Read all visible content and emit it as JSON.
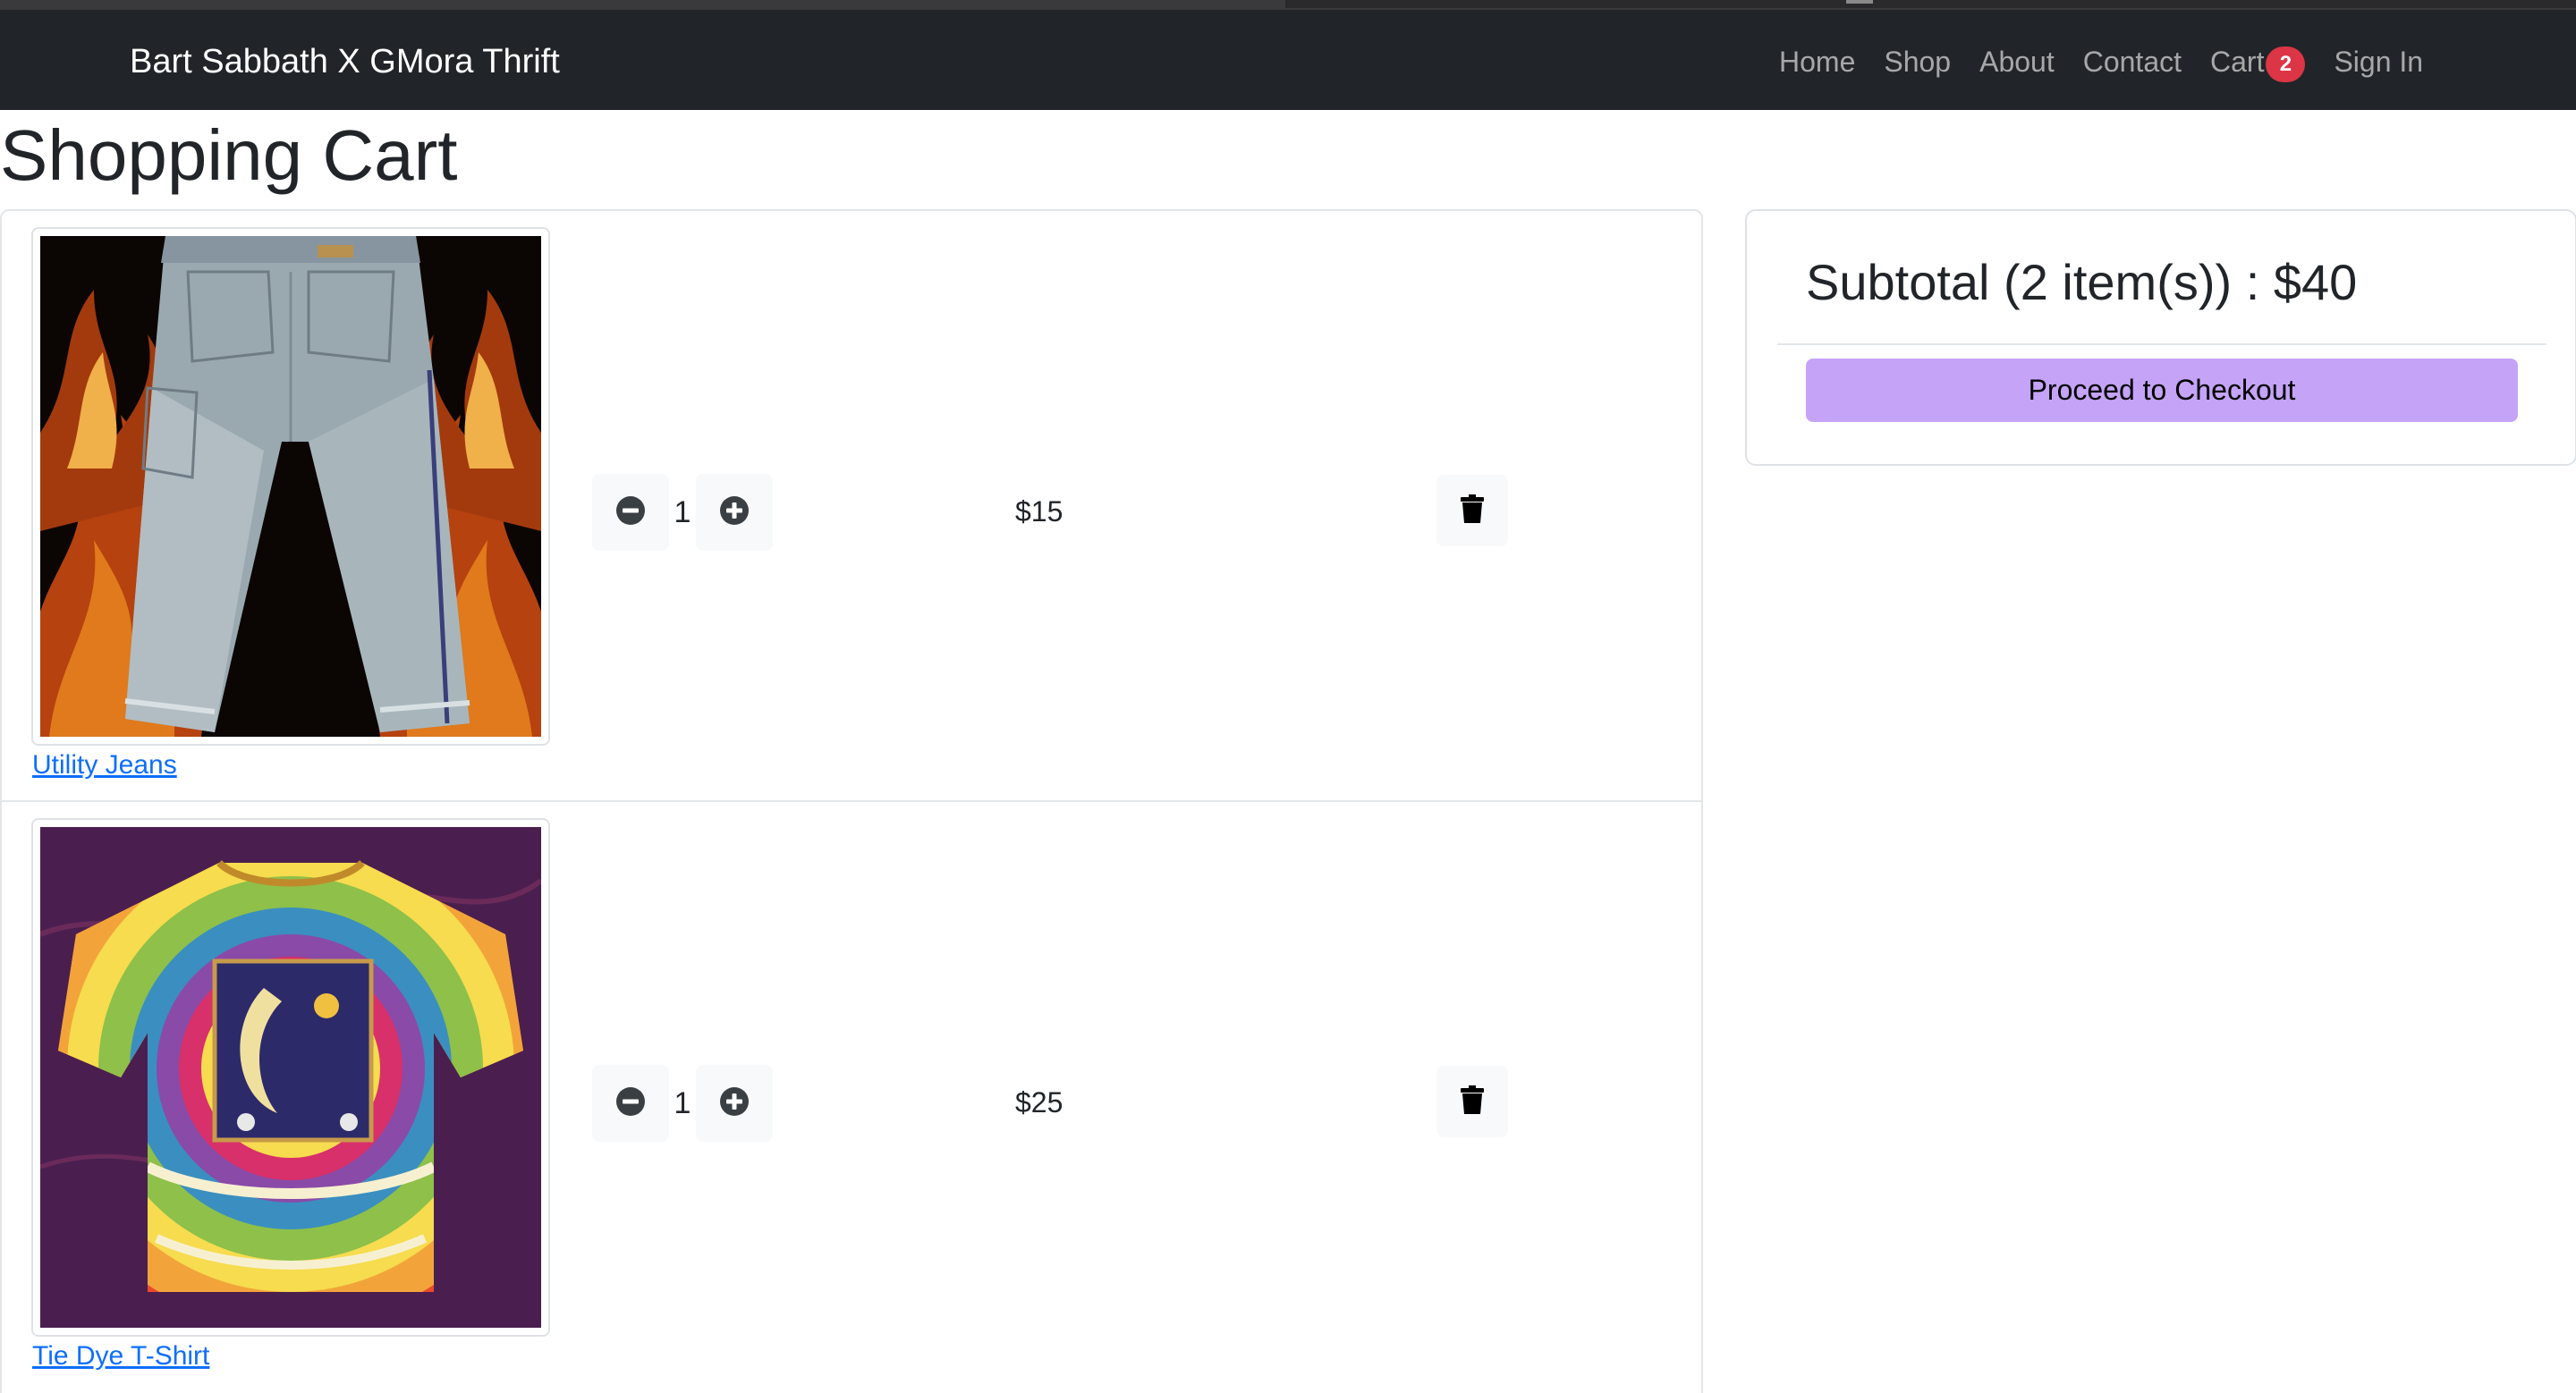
{
  "navbar": {
    "brand": "Bart Sabbath X GMora Thrift",
    "links": [
      "Home",
      "Shop",
      "About",
      "Contact"
    ],
    "cart_label": "Cart",
    "cart_count": "2",
    "signin_label": "Sign In"
  },
  "page": {
    "title": "Shopping Cart"
  },
  "cart": {
    "items": [
      {
        "name": "Utility Jeans",
        "quantity": "1",
        "price": "$15"
      },
      {
        "name": "Tie Dye T-Shirt",
        "quantity": "1",
        "price": "$25"
      }
    ]
  },
  "summary": {
    "subtotal_text": "Subtotal (2 item(s)) : $40",
    "checkout_label": "Proceed to Checkout"
  },
  "icons": {
    "decrement": "minus-circle-icon",
    "increment": "plus-circle-icon",
    "delete": "trash-icon"
  },
  "colors": {
    "navbar_bg": "#212529",
    "badge": "#dc3545",
    "checkout_button": "#c5a3f7",
    "link": "#0d6efd"
  }
}
